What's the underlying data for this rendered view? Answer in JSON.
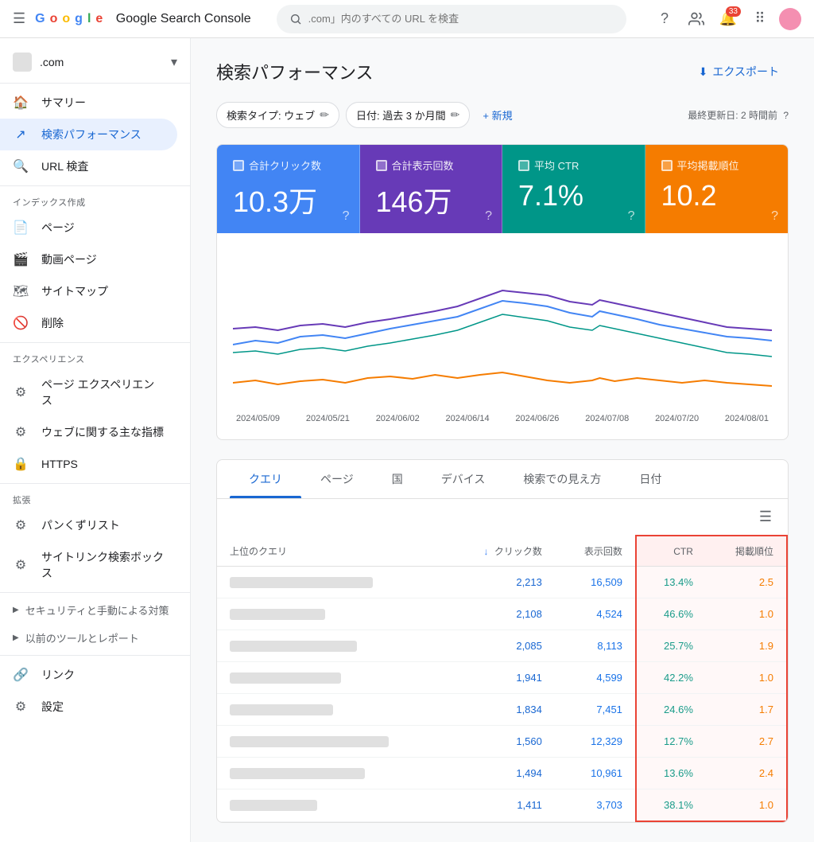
{
  "app": {
    "title": "Google Search Console",
    "logo_parts": [
      "G",
      "o",
      "o",
      "g",
      "l",
      "e"
    ],
    "site_domain": ".com",
    "search_placeholder": "」内のすべての URL を検査"
  },
  "topbar": {
    "notification_count": "33",
    "search_prefix": ".com"
  },
  "sidebar": {
    "nav_items": [
      {
        "id": "summary",
        "label": "サマリー",
        "icon": "🏠",
        "active": false
      },
      {
        "id": "search-performance",
        "label": "検索パフォーマンス",
        "icon": "📈",
        "active": true
      },
      {
        "id": "url-inspection",
        "label": "URL 検査",
        "icon": "🔍",
        "active": false
      }
    ],
    "sections": [
      {
        "title": "インデックス作成",
        "items": [
          {
            "id": "pages",
            "label": "ページ",
            "icon": "📄"
          },
          {
            "id": "video-pages",
            "label": "動画ページ",
            "icon": "🎬"
          },
          {
            "id": "sitemap",
            "label": "サイトマップ",
            "icon": "🗺"
          },
          {
            "id": "remove",
            "label": "削除",
            "icon": "🚫"
          }
        ]
      },
      {
        "title": "エクスペリエンス",
        "items": [
          {
            "id": "page-experience",
            "label": "ページ エクスペリエンス",
            "icon": "⚙"
          },
          {
            "id": "web-vitals",
            "label": "ウェブに関する主な指標",
            "icon": "⚙"
          },
          {
            "id": "https",
            "label": "HTTPS",
            "icon": "🔒"
          }
        ]
      },
      {
        "title": "拡張",
        "items": [
          {
            "id": "breadcrumbs",
            "label": "パンくずリスト",
            "icon": "⚙"
          },
          {
            "id": "sitelinks",
            "label": "サイトリンク検索ボックス",
            "icon": "⚙"
          }
        ]
      }
    ],
    "expandable": [
      {
        "label": "セキュリティと手動による対策"
      },
      {
        "label": "以前のツールとレポート"
      }
    ],
    "bottom_items": [
      {
        "id": "links",
        "label": "リンク",
        "icon": "🔗"
      },
      {
        "id": "settings",
        "label": "設定",
        "icon": "⚙"
      }
    ]
  },
  "page": {
    "title": "検索パフォーマンス",
    "export_label": "エクスポート",
    "filters": {
      "search_type": "検索タイプ: ウェブ",
      "date_range": "日付: 過去 3 か月間",
      "add_label": "+ 新規"
    },
    "last_updated": "最終更新日: 2 時間前"
  },
  "metrics": [
    {
      "id": "clicks",
      "label": "合計クリック数",
      "value": "10.3万",
      "color": "#4285f4"
    },
    {
      "id": "impressions",
      "label": "合計表示回数",
      "value": "146万",
      "color": "#673ab7"
    },
    {
      "id": "ctr",
      "label": "平均 CTR",
      "value": "7.1%",
      "color": "#009688"
    },
    {
      "id": "position",
      "label": "平均掲載順位",
      "value": "10.2",
      "color": "#f57c00"
    }
  ],
  "chart": {
    "x_labels": [
      "2024/05/09",
      "2024/05/21",
      "2024/06/02",
      "2024/06/14",
      "2024/06/26",
      "2024/07/08",
      "2024/07/20",
      "2024/08/01"
    ]
  },
  "tabs": {
    "items": [
      "クエリ",
      "ページ",
      "国",
      "デバイス",
      "検索での見え方",
      "日付"
    ],
    "active": 0
  },
  "table": {
    "headers": [
      "上位のクエリ",
      "クリック数",
      "表示回数",
      "CTR",
      "掲載順位"
    ],
    "sort_col": "クリック数",
    "rows": [
      {
        "query_width": 180,
        "clicks": "2,213",
        "impressions": "16,509",
        "ctr": "13.4%",
        "position": "2.5"
      },
      {
        "query_width": 120,
        "clicks": "2,108",
        "impressions": "4,524",
        "ctr": "46.6%",
        "position": "1.0"
      },
      {
        "query_width": 160,
        "clicks": "2,085",
        "impressions": "8,113",
        "ctr": "25.7%",
        "position": "1.9"
      },
      {
        "query_width": 140,
        "clicks": "1,941",
        "impressions": "4,599",
        "ctr": "42.2%",
        "position": "1.0"
      },
      {
        "query_width": 130,
        "clicks": "1,834",
        "impressions": "7,451",
        "ctr": "24.6%",
        "position": "1.7"
      },
      {
        "query_width": 200,
        "clicks": "1,560",
        "impressions": "12,329",
        "ctr": "12.7%",
        "position": "2.7"
      },
      {
        "query_width": 170,
        "clicks": "1,494",
        "impressions": "10,961",
        "ctr": "13.6%",
        "position": "2.4"
      },
      {
        "query_width": 110,
        "clicks": "1,411",
        "impressions": "3,703",
        "ctr": "38.1%",
        "position": "1.0"
      }
    ]
  }
}
